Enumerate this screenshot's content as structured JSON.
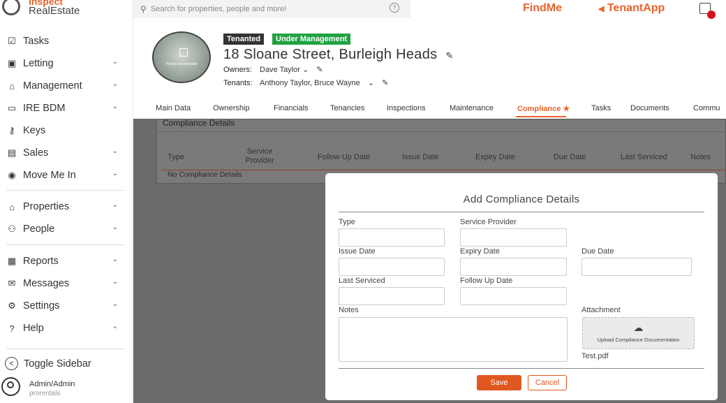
{
  "brand": {
    "line1": "Inspect",
    "line2": "RealEstate"
  },
  "search": {
    "placeholder": "Search for properties, people and more!",
    "help_glyph": "?"
  },
  "topbar": {
    "findme": "FindMe",
    "tenantapp": "TenantApp",
    "tenantapp_glyph": "◀"
  },
  "sidebar": {
    "items": [
      {
        "label": "Tasks",
        "icon": "tasks-icon",
        "glyph": "☑",
        "chevron": false
      },
      {
        "label": "Letting",
        "icon": "letting-icon",
        "glyph": "▣",
        "chevron": true
      },
      {
        "label": "Management",
        "icon": "management-icon",
        "glyph": "⌂",
        "chevron": true
      },
      {
        "label": "IRE BDM",
        "icon": "bdm-icon",
        "glyph": "▭",
        "chevron": true
      },
      {
        "label": "Keys",
        "icon": "keys-icon",
        "glyph": "⚷",
        "chevron": false
      },
      {
        "label": "Sales",
        "icon": "sales-icon",
        "glyph": "▤",
        "chevron": true
      },
      {
        "label": "Move Me In",
        "icon": "move-me-in-icon",
        "glyph": "◉",
        "chevron": true
      },
      {
        "label": "Properties",
        "icon": "properties-icon",
        "glyph": "⌂",
        "chevron": true
      },
      {
        "label": "People",
        "icon": "people-icon",
        "glyph": "⚇",
        "chevron": true
      },
      {
        "label": "Reports",
        "icon": "reports-icon",
        "glyph": "▦",
        "chevron": true
      },
      {
        "label": "Messages",
        "icon": "messages-icon",
        "glyph": "✉",
        "chevron": true
      },
      {
        "label": "Settings",
        "icon": "settings-icon",
        "glyph": "⚙",
        "chevron": true
      },
      {
        "label": "Help",
        "icon": "help-icon",
        "glyph": "?",
        "chevron": true
      }
    ],
    "chevron_glyph": "⌄",
    "toggle_label": "Toggle Sidebar",
    "toggle_glyph": "<",
    "user_name": "Admin/Admin",
    "user_org": "prorentals"
  },
  "property": {
    "photo_caption": "Picture not provided",
    "badge_tenanted": "Tenanted",
    "badge_management": "Under Management",
    "address": "18 Sloane Street, Burleigh Heads",
    "owners_label": "Owners:",
    "owners_value": "Dave Taylor",
    "tenants_label": "Tenants:",
    "tenants_value": "Anthony Taylor, Bruce Wayne",
    "edit_glyph": "✎",
    "caret_glyph": "⌄"
  },
  "tabs": [
    {
      "label": "Main Data"
    },
    {
      "label": "Ownership"
    },
    {
      "label": "Financials"
    },
    {
      "label": "Tenancies"
    },
    {
      "label": "Inspections"
    },
    {
      "label": "Maintenance"
    },
    {
      "label": "Compliance ★"
    },
    {
      "label": "Tasks"
    },
    {
      "label": "Documents"
    },
    {
      "label": "Commu"
    }
  ],
  "compliance_table": {
    "title": "Compliance Details",
    "headers": [
      "Type",
      "Service Provider",
      "Follow Up Date",
      "Issue Date",
      "Expiry Date",
      "Due Date",
      "Last Serviced",
      "Notes"
    ],
    "empty_text": "No Compliance Details"
  },
  "modal": {
    "title": "Add Compliance Details",
    "labels": {
      "type": "Type",
      "service_provider": "Service Provider",
      "issue_date": "Issue Date",
      "expiry_date": "Expiry Date",
      "due_date": "Due Date",
      "last_serviced": "Last Serviced",
      "follow_up_date": "Follow Up Date",
      "notes": "Notes",
      "attachment": "Attachment"
    },
    "values": {
      "type": "",
      "service_provider": "",
      "issue_date": "",
      "expiry_date": "",
      "due_date": "",
      "last_serviced": "",
      "follow_up_date": "",
      "notes": ""
    },
    "upload_label": "Upload Compliance Documentation",
    "upload_glyph": "☁",
    "attached_file": "Test.pdf",
    "save_label": "Save",
    "cancel_label": "Cancel"
  },
  "colors": {
    "accent": "#e8632b",
    "success": "#21a244",
    "dark": "#333333",
    "overlay": "#6b6b6b"
  }
}
